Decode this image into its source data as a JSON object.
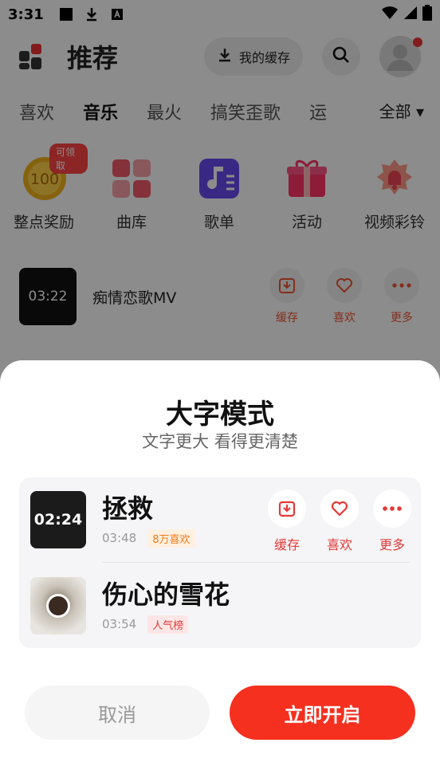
{
  "status_bar": {
    "time": "3:31"
  },
  "header": {
    "title": "推荐",
    "cache_label": "我的缓存"
  },
  "tabs": [
    "喜欢",
    "音乐",
    "最火",
    "搞笑歪歌",
    "运"
  ],
  "tab_all": "全部",
  "features": [
    {
      "label": "整点奖励",
      "badge": "可领取",
      "coin": "100"
    },
    {
      "label": "曲库"
    },
    {
      "label": "歌单"
    },
    {
      "label": "活动"
    },
    {
      "label": "视频彩铃"
    }
  ],
  "background_song": {
    "duration": "03:22",
    "title": "痴情恋歌MV",
    "actions": [
      "缓存",
      "喜欢",
      "更多"
    ]
  },
  "dialog": {
    "title": "大字模式",
    "subtitle": "文字更大 看得更清楚",
    "songs": [
      {
        "thumb_text": "02:24",
        "title": "拯救",
        "duration": "03:48",
        "tag": "8万喜欢",
        "actions": [
          "缓存",
          "喜欢",
          "更多"
        ]
      },
      {
        "title": "伤心的雪花",
        "duration": "03:54",
        "tag": "人气榜"
      }
    ],
    "cancel_label": "取消",
    "confirm_label": "立即开启"
  },
  "colors": {
    "accent": "#f6301f",
    "tag_orange": "#f07a1a",
    "tag_red": "#e53935"
  }
}
